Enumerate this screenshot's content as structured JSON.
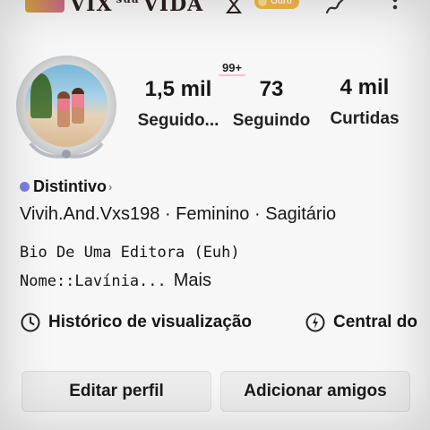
{
  "header": {
    "logo_text": "VIX",
    "logo_small": "sua",
    "logo_text2": "VIDA",
    "gold_badge": "Ouro",
    "icons": [
      "edit-icon",
      "more-icon"
    ]
  },
  "profile": {
    "notif_badge": "99+",
    "stats": [
      {
        "value": "1,5 mil",
        "label": "Seguido..."
      },
      {
        "value": "73",
        "label": "Seguindo"
      },
      {
        "value": "4 mil",
        "label": "Curtidas"
      }
    ],
    "badge_label": "Distintivo",
    "meta": "Vivih.And.Vxs198 · Feminino · Sagitário",
    "bio_line1": "Bio De Uma Editora (Euh)",
    "bio_line2": "Nome::Lavínia...",
    "more_label": "Mais"
  },
  "links": {
    "history": "Histórico de visualização",
    "center": "Central do"
  },
  "buttons": {
    "edit": "Editar perfil",
    "add_friends": "Adicionar amigos"
  },
  "colors": {
    "badge_gold": "#f2b84b",
    "shield": "#7a7fe0",
    "notif_underline": "#f4c2cb"
  }
}
